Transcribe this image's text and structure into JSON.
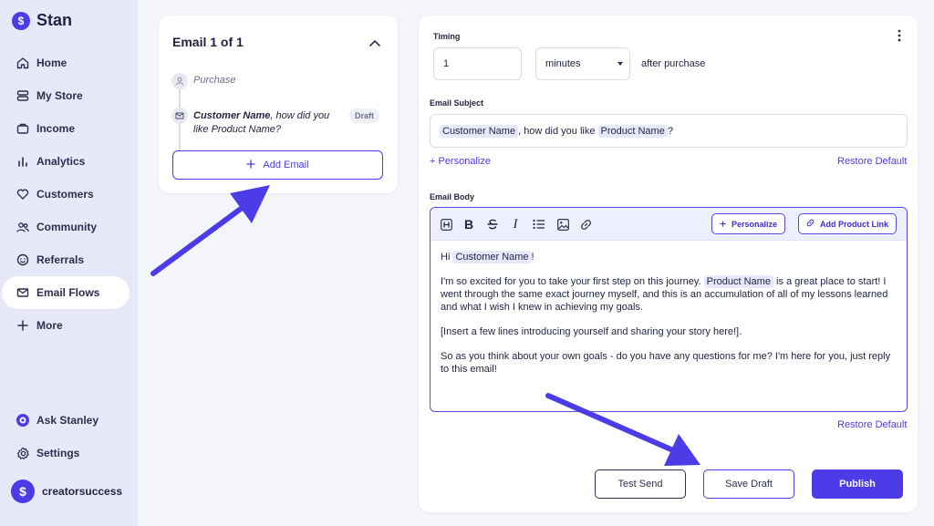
{
  "sidebar": {
    "brand": "Stan",
    "items": [
      {
        "label": "Home",
        "icon": "home-icon"
      },
      {
        "label": "My Store",
        "icon": "store-icon"
      },
      {
        "label": "Income",
        "icon": "wallet-icon"
      },
      {
        "label": "Analytics",
        "icon": "bar-chart-icon"
      },
      {
        "label": "Customers",
        "icon": "heart-icon"
      },
      {
        "label": "Community",
        "icon": "users-icon"
      },
      {
        "label": "Referrals",
        "icon": "smile-icon"
      },
      {
        "label": "Email Flows",
        "icon": "mail-icon",
        "active": true
      },
      {
        "label": "More",
        "icon": "plus-icon"
      }
    ],
    "bottom": [
      {
        "label": "Ask Stanley",
        "icon": "bot-icon"
      },
      {
        "label": "Settings",
        "icon": "gear-icon"
      }
    ],
    "user": "creatorsuccess"
  },
  "flow": {
    "title": "Email 1 of 1",
    "trigger": "Purchase",
    "email_name": "Customer Name",
    "email_mid": ", how did you like ",
    "email_product": "Product Name",
    "email_end": "?",
    "badge": "Draft",
    "add_email": "Add Email"
  },
  "editor": {
    "timing_label": "Timing",
    "timing_value": "1",
    "timing_unit": "minutes",
    "after_text": "after purchase",
    "subject_label": "Email Subject",
    "subject_token1": "Customer Name",
    "subject_mid": ", how did you like ",
    "subject_token2": "Product Name",
    "subject_end": "?",
    "personalize_link": "+ Personalize",
    "restore_default": "Restore Default",
    "body_label": "Email Body",
    "toolbar_personalize": "Personalize",
    "toolbar_add_product": "Add Product Link",
    "body": {
      "greeting_pre": "Hi ",
      "greeting_token": "Customer Name",
      "greeting_post": "!",
      "p1_pre": "I'm so excited for you to take your first step on this journey. ",
      "p1_token": "Product Name",
      "p1_post": " is a great place to start! I went through the same exact journey myself, and this is an accumulation of all of my lessons learned and what I wish I knew in achieving my goals.",
      "p2": "[Insert a few lines introducing yourself and sharing your story here!].",
      "p3": "So as you think about your own goals - do you have any questions for me? I'm here for you, just reply to this email!"
    },
    "restore_default_2": "Restore Default",
    "test_send": "Test Send",
    "save_draft": "Save Draft",
    "publish": "Publish"
  },
  "colors": {
    "accent": "#4b3ce8",
    "sidebar_bg": "#e8e9f8",
    "page_bg": "#f4f5fb",
    "annotation_arrow": "#4b3ce8"
  }
}
